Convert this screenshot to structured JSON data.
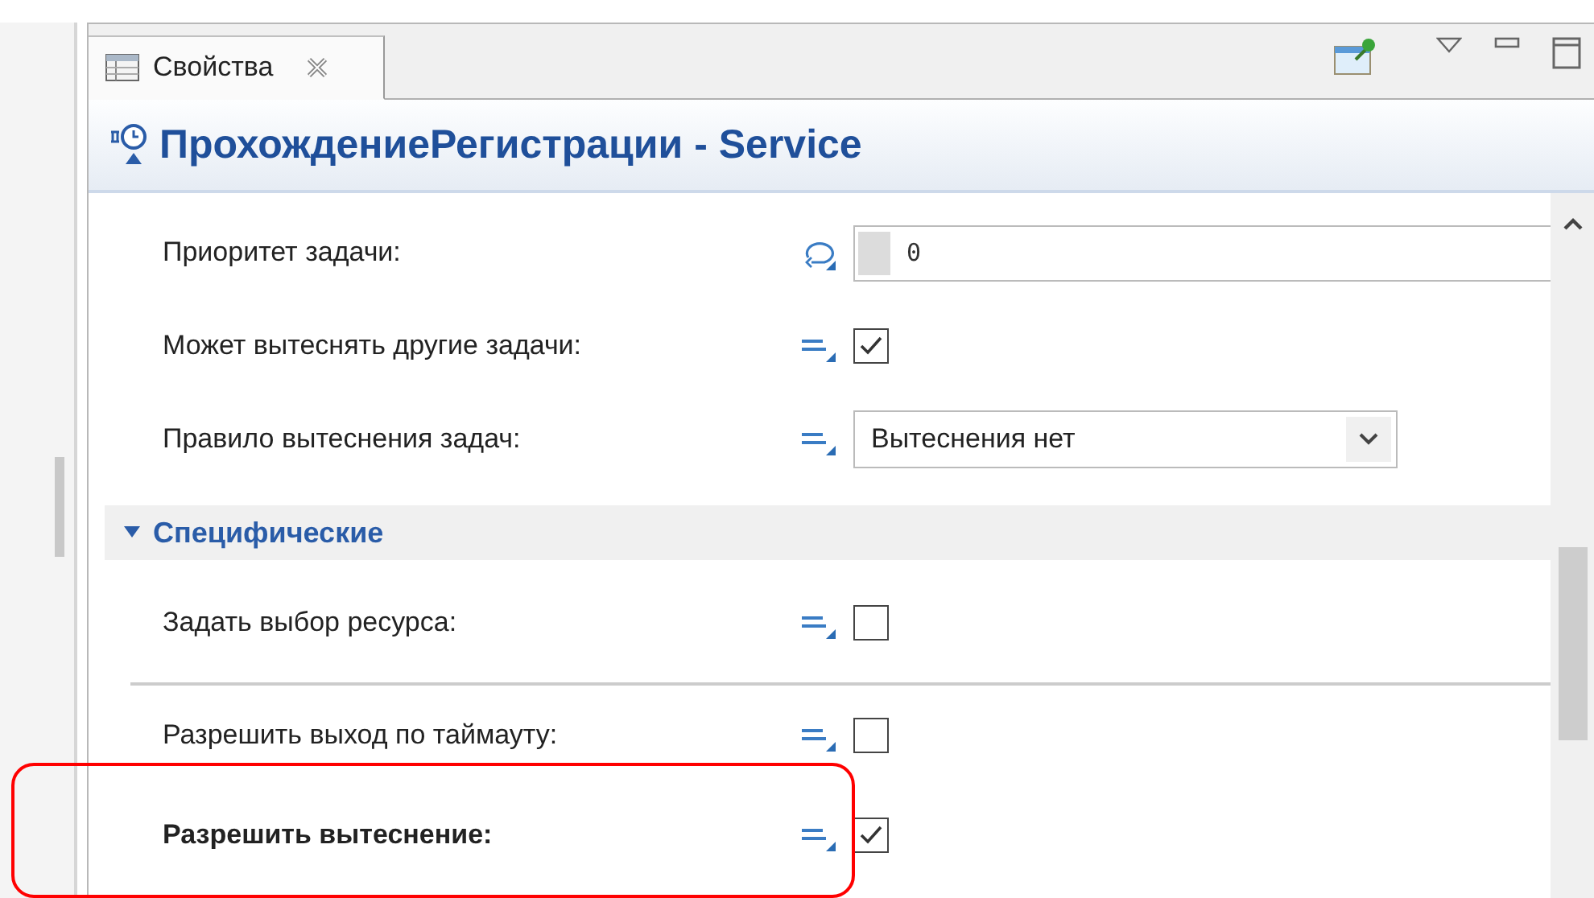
{
  "tab": {
    "label": "Свойства",
    "selected": true
  },
  "title": "ПрохождениеРегистрации - Service",
  "properties": [
    {
      "kind": "number",
      "label": "Приоритет задачи:",
      "value": "0"
    },
    {
      "kind": "checkbox",
      "label": "Может вытеснять другие задачи:",
      "checked": true
    },
    {
      "kind": "combo",
      "label": "Правило вытеснения задач:",
      "value": "Вытеснения нет"
    }
  ],
  "section": {
    "label": "Специфические",
    "expanded": true,
    "groups": [
      [
        {
          "kind": "checkbox",
          "label": "Задать выбор ресурса:",
          "checked": false,
          "highlighted": false
        }
      ],
      [
        {
          "kind": "checkbox",
          "label": "Разрешить выход по таймауту:",
          "checked": false,
          "highlighted": false
        },
        {
          "kind": "checkbox",
          "label": "Разрешить вытеснение:",
          "checked": true,
          "highlighted": true
        }
      ]
    ]
  }
}
